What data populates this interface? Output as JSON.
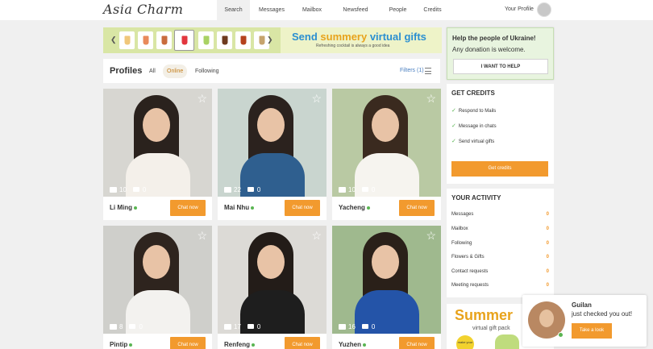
{
  "brand": "Asia Charm",
  "nav": {
    "items": [
      "Search",
      "Messages",
      "Mailbox",
      "Newsfeed",
      "People",
      "Credits"
    ],
    "active": "Search",
    "profile": "Your Profile"
  },
  "banner": {
    "headline_1": "Send ",
    "headline_2": "summery",
    "headline_3": " virtual gifts",
    "subline": "Refreshing cocktail is always a good idea"
  },
  "profiles_bar": {
    "title": "Profiles",
    "tabs": [
      "All",
      "Online",
      "Following"
    ],
    "selected_tab": "Online",
    "filters": "Filters (1)"
  },
  "cards": [
    {
      "name": "Li Ming",
      "photos": "10",
      "videos": "0",
      "chat": "Chat now"
    },
    {
      "name": "Mai Nhu",
      "photos": "22",
      "videos": "0",
      "chat": "Chat now"
    },
    {
      "name": "Yacheng",
      "photos": "10",
      "videos": "0",
      "chat": "Chat now"
    },
    {
      "name": "Pintip",
      "photos": "8",
      "videos": "0",
      "chat": "Chat now"
    },
    {
      "name": "Renfeng",
      "photos": "17",
      "videos": "0",
      "chat": "Chat now"
    },
    {
      "name": "Yuzhen",
      "photos": "16",
      "videos": "0",
      "chat": "Chat now"
    }
  ],
  "help": {
    "title": "Help the people of Ukraine!",
    "subtitle": "Any donation is welcome.",
    "button": "I WANT TO HELP"
  },
  "credits": {
    "title": "GET CREDITS",
    "items": [
      "Respond to Mails",
      "Message in chats",
      "Send virtual gifts"
    ],
    "button": "Get credits"
  },
  "activity": {
    "title": "YOUR ACTIVITY",
    "rows": [
      {
        "label": "Messages",
        "count": "0"
      },
      {
        "label": "Mailbox",
        "count": "0"
      },
      {
        "label": "Following",
        "count": "0"
      },
      {
        "label": "Flowers & Gifts",
        "count": "0"
      },
      {
        "label": "Contact requests",
        "count": "0"
      },
      {
        "label": "Meeting requests",
        "count": "0"
      }
    ]
  },
  "promo": {
    "big": "Summer",
    "sub": "virtual gift pack",
    "badge": "make your"
  },
  "popup": {
    "name": "Guilan",
    "message_1": "just checked you out!",
    "button": "Take a look"
  },
  "colors": {
    "accent": "#f29a2e",
    "online": "#5ab552",
    "banner_bg": "#d9e6a5",
    "link": "#4a7fc0"
  }
}
